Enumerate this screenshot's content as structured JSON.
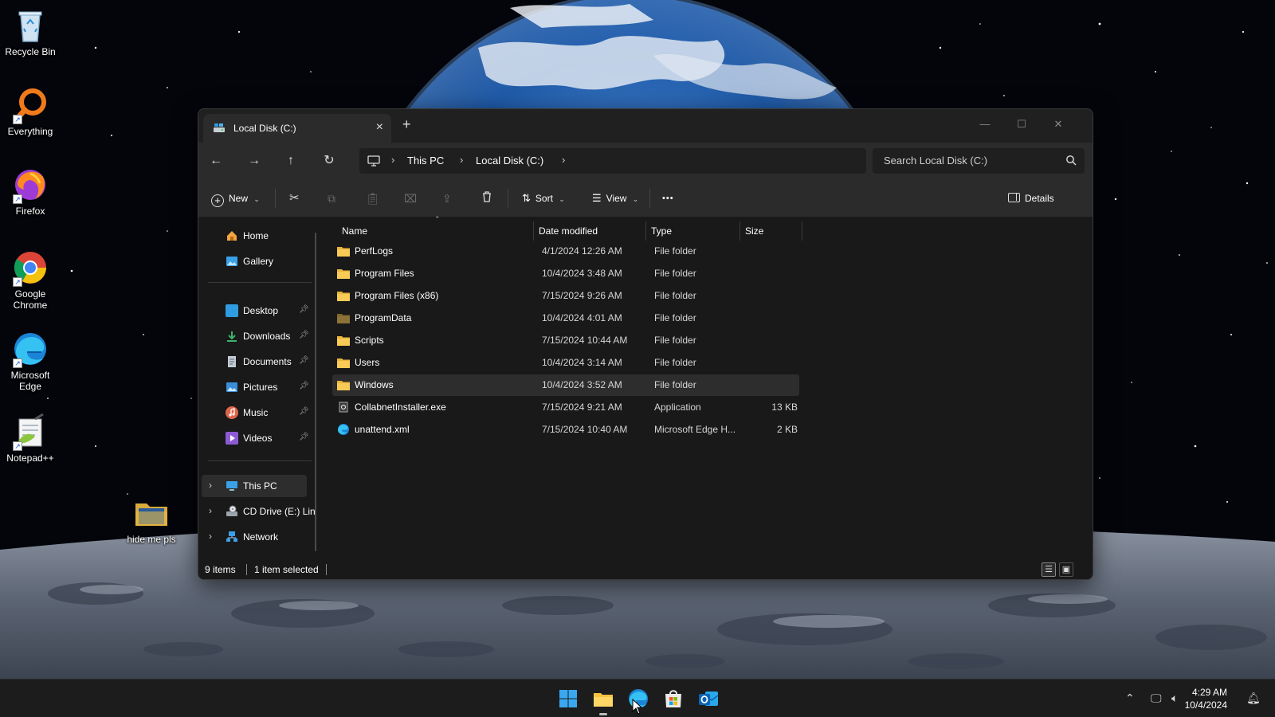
{
  "desktop": {
    "icons": [
      {
        "label": "Recycle Bin"
      },
      {
        "label": "Everything"
      },
      {
        "label": "Firefox"
      },
      {
        "label": "Google Chrome"
      },
      {
        "label": "Microsoft Edge"
      },
      {
        "label": "Notepad++"
      },
      {
        "label": "hide me pls"
      }
    ]
  },
  "window": {
    "tab_title": "Local Disk (C:)",
    "breadcrumb": [
      "This PC",
      "Local Disk (C:)"
    ],
    "search_placeholder": "Search Local Disk (C:)",
    "toolbar": {
      "new_label": "New",
      "sort_label": "Sort",
      "view_label": "View",
      "more_label": "•••",
      "details_label": "Details"
    },
    "nav": {
      "quick": [
        {
          "label": "Home",
          "color": "#f2a541"
        },
        {
          "label": "Gallery",
          "color": "#3aa0e8"
        }
      ],
      "pinned": [
        {
          "label": "Desktop",
          "color": "#2f9be0"
        },
        {
          "label": "Downloads",
          "color": "#3bb36a"
        },
        {
          "label": "Documents",
          "color": "#8a9bb0"
        },
        {
          "label": "Pictures",
          "color": "#3a8ed8"
        },
        {
          "label": "Music",
          "color": "#e0654a"
        },
        {
          "label": "Videos",
          "color": "#8d5ad6"
        }
      ],
      "tree": [
        {
          "label": "This PC",
          "color": "#3aa0e8"
        },
        {
          "label": "CD Drive (E:) Lin",
          "color": "#9aa4ad"
        },
        {
          "label": "Network",
          "color": "#3aa0e8"
        }
      ]
    },
    "columns": {
      "name": "Name",
      "date": "Date modified",
      "type": "Type",
      "size": "Size"
    },
    "files": [
      {
        "name": "PerfLogs",
        "date": "4/1/2024 12:26 AM",
        "type": "File folder",
        "size": "",
        "kind": "folder"
      },
      {
        "name": "Program Files",
        "date": "10/4/2024 3:48 AM",
        "type": "File folder",
        "size": "",
        "kind": "folder"
      },
      {
        "name": "Program Files (x86)",
        "date": "7/15/2024 9:26 AM",
        "type": "File folder",
        "size": "",
        "kind": "folder"
      },
      {
        "name": "ProgramData",
        "date": "10/4/2024 4:01 AM",
        "type": "File folder",
        "size": "",
        "kind": "folder-hidden"
      },
      {
        "name": "Scripts",
        "date": "7/15/2024 10:44 AM",
        "type": "File folder",
        "size": "",
        "kind": "folder"
      },
      {
        "name": "Users",
        "date": "10/4/2024 3:14 AM",
        "type": "File folder",
        "size": "",
        "kind": "folder"
      },
      {
        "name": "Windows",
        "date": "10/4/2024 3:52 AM",
        "type": "File folder",
        "size": "",
        "kind": "folder",
        "selected": true
      },
      {
        "name": "CollabnetInstaller.exe",
        "date": "7/15/2024 9:21 AM",
        "type": "Application",
        "size": "13 KB",
        "kind": "exe"
      },
      {
        "name": "unattend.xml",
        "date": "7/15/2024 10:40 AM",
        "type": "Microsoft Edge H...",
        "size": "2 KB",
        "kind": "edge"
      }
    ],
    "status": {
      "count": "9 items",
      "selection": "1 item selected"
    }
  },
  "taskbar": {
    "time": "4:29 AM",
    "date": "10/4/2024"
  }
}
